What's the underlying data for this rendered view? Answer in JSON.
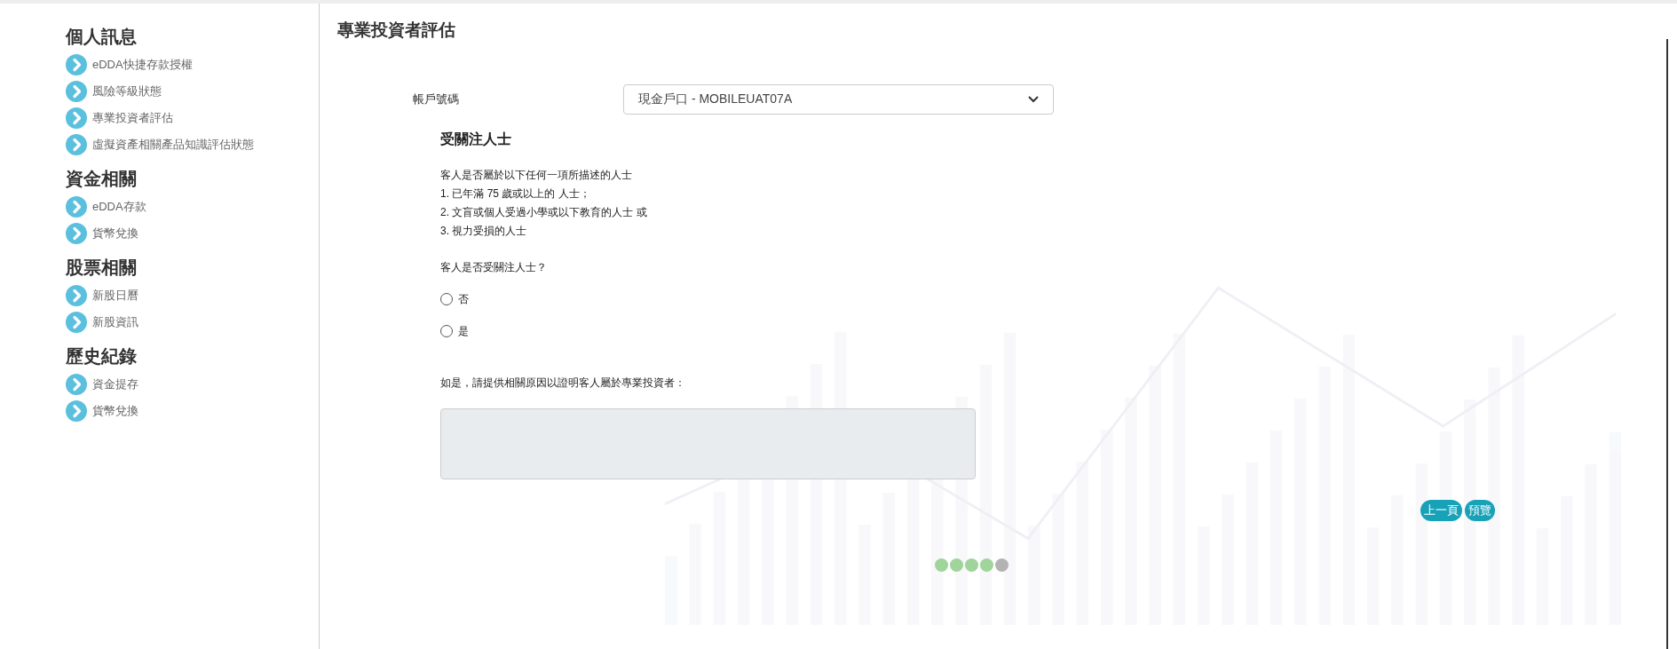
{
  "sidebar": {
    "sections": [
      {
        "title": "個人訊息",
        "items": [
          {
            "label": "eDDA快捷存款授權"
          },
          {
            "label": "風險等級狀態"
          },
          {
            "label": "專業投資者評估"
          },
          {
            "label": "虛擬資產相關產品知識評估狀態"
          }
        ]
      },
      {
        "title": "資金相關",
        "items": [
          {
            "label": "eDDA存款"
          },
          {
            "label": "貨幣兌換"
          }
        ]
      },
      {
        "title": "股票相關",
        "items": [
          {
            "label": "新股日曆"
          },
          {
            "label": "新股資訊"
          }
        ]
      },
      {
        "title": "歷史紀錄",
        "items": [
          {
            "label": "資金提存"
          },
          {
            "label": "貨幣兌換"
          }
        ]
      }
    ]
  },
  "page_title": "專業投資者評估",
  "account": {
    "label": "帳戶號碼",
    "value": "現金戶口 - MOBILEUAT07A"
  },
  "section": {
    "title": "受關注人士",
    "description": [
      "客人是否屬於以下任何一項所描述的人士",
      "1. 已年滿 75 歲或以上的 人士；",
      "2. 文盲或個人受過小學或以下教育的人士 或",
      "3. 視力受損的人士"
    ],
    "question": "客人是否受關注人士？",
    "options": [
      {
        "label": "否",
        "selected": false
      },
      {
        "label": "是",
        "selected": false
      }
    ],
    "reason_label": "如是，請提供相關原因以證明客人屬於專業投資者：",
    "reason_disabled": true
  },
  "buttons": [
    "上一頁",
    "預覽"
  ],
  "steps": [
    {
      "done": true
    },
    {
      "done": true
    },
    {
      "done": true
    },
    {
      "done": true
    },
    {
      "done": false
    }
  ]
}
